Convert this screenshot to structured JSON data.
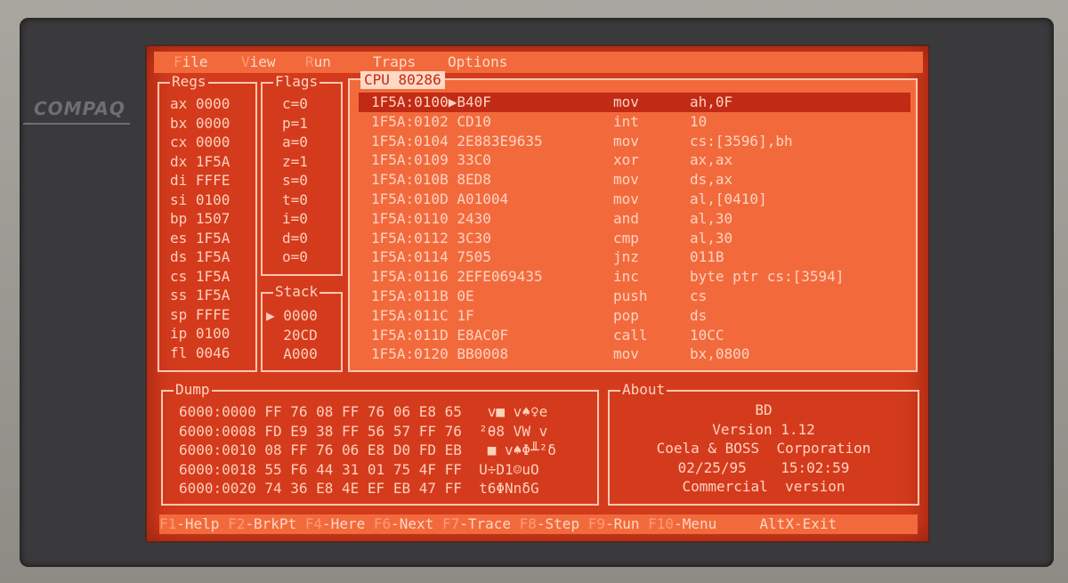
{
  "menu": {
    "items": [
      {
        "label": "File",
        "hot": "F",
        "rest": "ile"
      },
      {
        "label": "View",
        "hot": "V",
        "rest": "iew"
      },
      {
        "label": "Run",
        "hot": "R",
        "rest": "un"
      },
      {
        "label": "Traps",
        "hot": "",
        "rest": "Traps"
      },
      {
        "label": "Options",
        "hot": "",
        "rest": "Options"
      }
    ]
  },
  "regs": {
    "title": "Regs",
    "lines": [
      "ax 0000",
      "bx 0000",
      "cx 0000",
      "dx 1F5A",
      "di FFFE",
      "si 0100",
      "bp 1507",
      "es 1F5A",
      "ds 1F5A",
      "cs 1F5A",
      "ss 1F5A",
      "sp FFFE",
      "ip 0100",
      "fl 0046"
    ]
  },
  "flags": {
    "title": "Flags",
    "lines": [
      "c=0",
      "p=1",
      "a=0",
      "z=1",
      "s=0",
      "t=0",
      "i=0",
      "d=0",
      "o=0"
    ]
  },
  "stack": {
    "title": "Stack",
    "lines": [
      "▶ 0000",
      "  20CD",
      "  A000"
    ]
  },
  "cpu": {
    "title": "CPU 80286",
    "rows": [
      {
        "addr": "1F5A:0100▶B40F",
        "op": "mov",
        "arg": "ah,0F"
      },
      {
        "addr": "1F5A:0102 CD10",
        "op": "int",
        "arg": "10"
      },
      {
        "addr": "1F5A:0104 2E883E9635",
        "op": "mov",
        "arg": "cs:[3596],bh"
      },
      {
        "addr": "1F5A:0109 33C0",
        "op": "xor",
        "arg": "ax,ax"
      },
      {
        "addr": "1F5A:010B 8ED8",
        "op": "mov",
        "arg": "ds,ax"
      },
      {
        "addr": "1F5A:010D A01004",
        "op": "mov",
        "arg": "al,[0410]"
      },
      {
        "addr": "1F5A:0110 2430",
        "op": "and",
        "arg": "al,30"
      },
      {
        "addr": "1F5A:0112 3C30",
        "op": "cmp",
        "arg": "al,30"
      },
      {
        "addr": "1F5A:0114 7505",
        "op": "jnz",
        "arg": "011B"
      },
      {
        "addr": "1F5A:0116 2EFE069435",
        "op": "inc",
        "arg": "byte ptr cs:[3594]"
      },
      {
        "addr": "1F5A:011B 0E",
        "op": "push",
        "arg": "cs"
      },
      {
        "addr": "1F5A:011C 1F",
        "op": "pop",
        "arg": "ds"
      },
      {
        "addr": "1F5A:011D E8AC0F",
        "op": "call",
        "arg": "10CC"
      },
      {
        "addr": "1F5A:0120 BB0008",
        "op": "mov",
        "arg": "bx,0800"
      }
    ]
  },
  "dump": {
    "title": "Dump",
    "lines": [
      "6000:0000 FF 76 08 FF 76 06 E8 65   v■ v♠♀e",
      "6000:0008 FD E9 38 FF 56 57 FF 76  ²θ8 VW v",
      "6000:0010 08 FF 76 06 E8 D0 FD EB   ■ v♠Φ╨²δ",
      "6000:0018 55 F6 44 31 01 75 4F FF  U÷D1☺uO",
      "6000:0020 74 36 E8 4E EF EB 47 FF  t6ΦNnδG"
    ]
  },
  "about": {
    "title": "About",
    "lines": [
      "BD",
      "Version 1.12",
      "Coela & BOSS  Corporation",
      "02/25/95    15:02:59",
      "Commercial  version"
    ]
  },
  "status": {
    "items": [
      {
        "key": "F1",
        "label": "-Help"
      },
      {
        "key": "F2",
        "label": "-BrkPt"
      },
      {
        "key": "F4",
        "label": "-Here"
      },
      {
        "key": "F6",
        "label": "-Next"
      },
      {
        "key": "F7",
        "label": "-Trace"
      },
      {
        "key": "F8",
        "label": "-Step"
      },
      {
        "key": "F9",
        "label": "-Run"
      },
      {
        "key": "F10",
        "label": "-Menu"
      },
      {
        "key": "Alt",
        "label": "X-Exit"
      }
    ]
  },
  "brand": "COMPAQ"
}
